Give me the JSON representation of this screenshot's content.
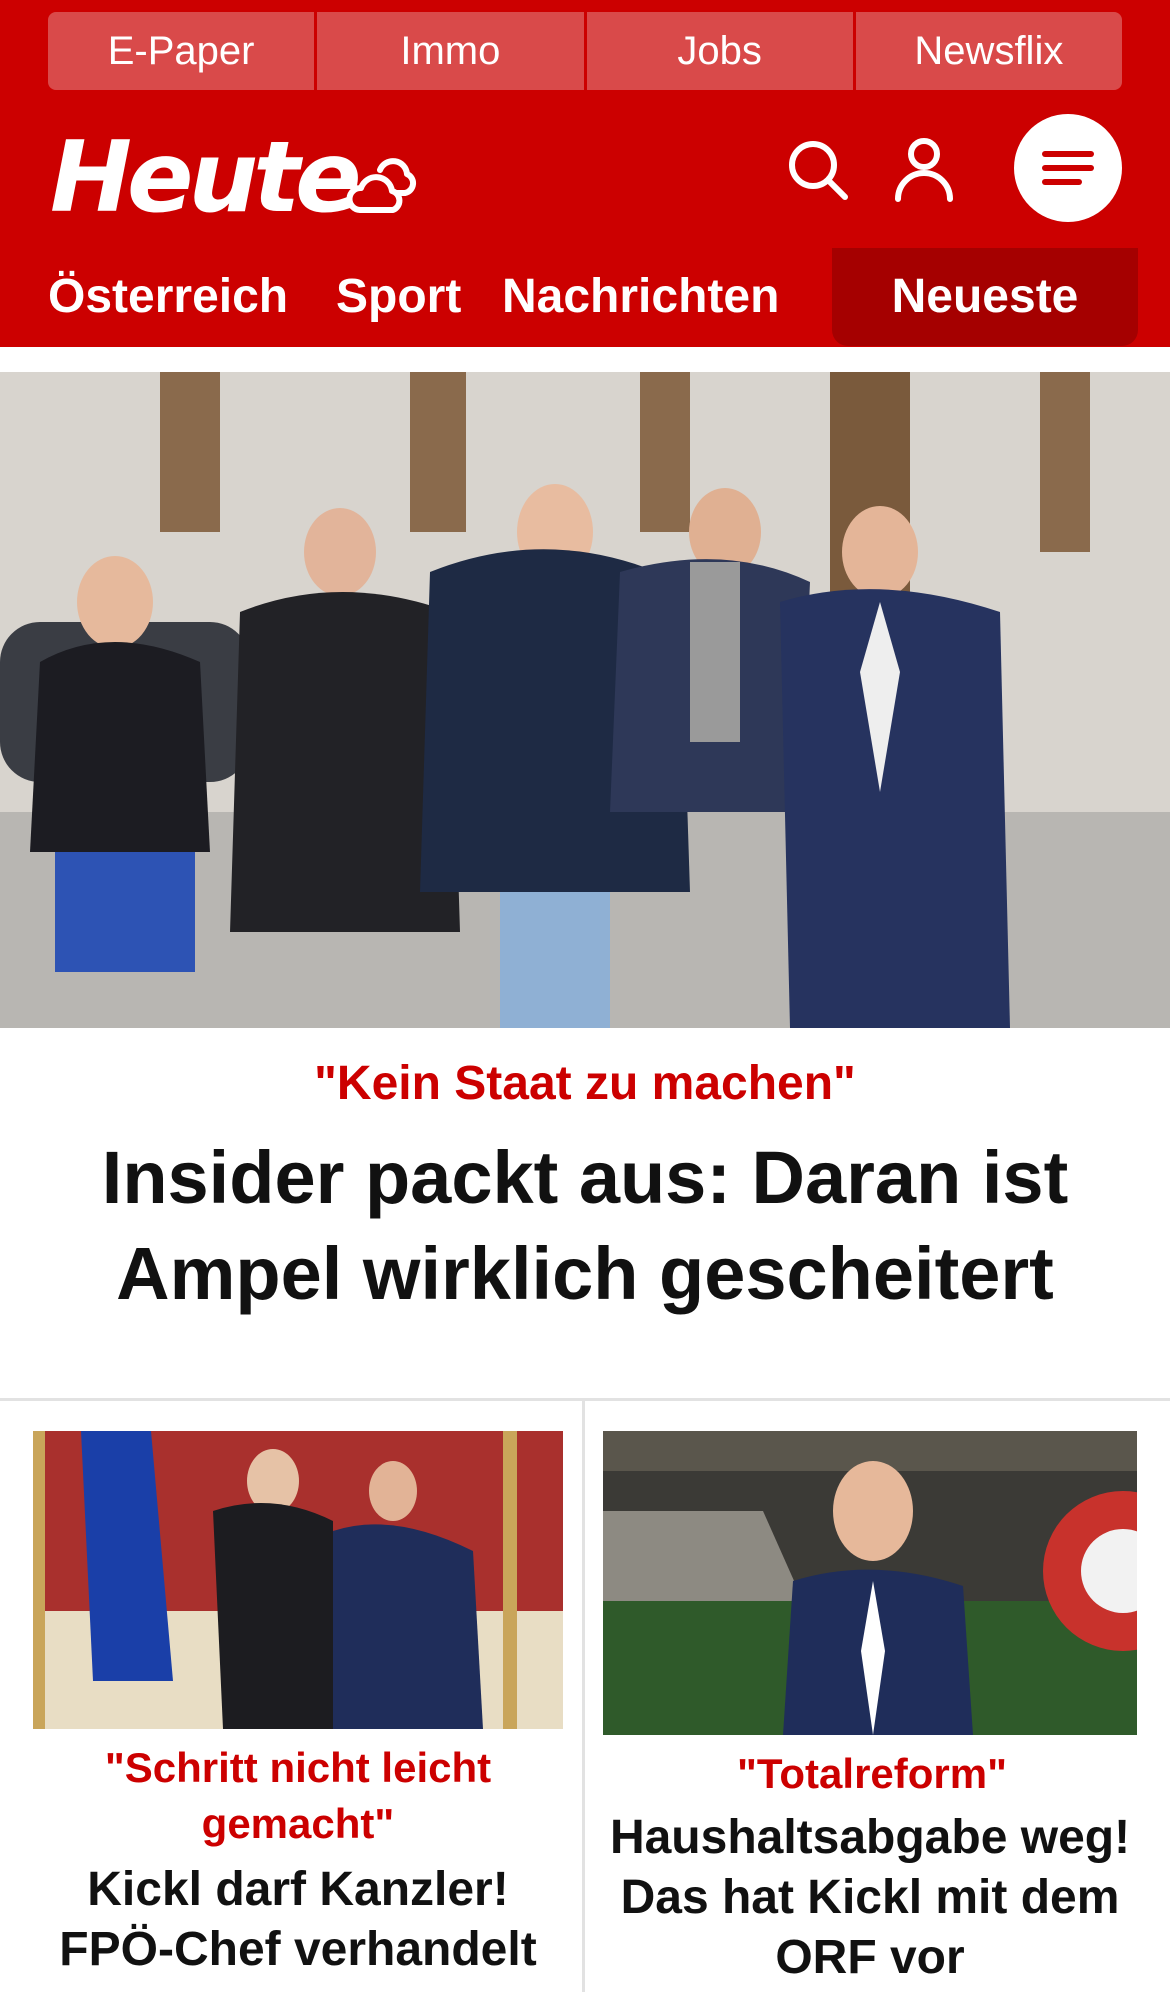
{
  "topnav": {
    "items": [
      "E-Paper",
      "Immo",
      "Jobs",
      "Newsflix"
    ]
  },
  "brand": {
    "logo": "Heute"
  },
  "secnav": {
    "items": [
      "Österreich",
      "Sport",
      "Nachrichten"
    ],
    "active": "Neueste"
  },
  "hero": {
    "kicker": "\"Kein Staat zu machen\"",
    "title": "Insider packt aus: Daran ist Ampel wirklich gescheitert"
  },
  "cards": [
    {
      "kicker": "\"Schritt nicht leicht gemacht\"",
      "title": "Kickl darf Kanzler! FPÖ-Chef verhandelt"
    },
    {
      "kicker": "\"Totalreform\"",
      "title": "Haushaltsabgabe weg! Das hat Kickl mit dem ORF vor"
    }
  ],
  "colors": {
    "brand_red": "#cc0000",
    "active_tab": "#a50000",
    "kicker": "#cc0000"
  },
  "icons": [
    "weather-icon",
    "search-icon",
    "user-icon",
    "menu-icon"
  ]
}
